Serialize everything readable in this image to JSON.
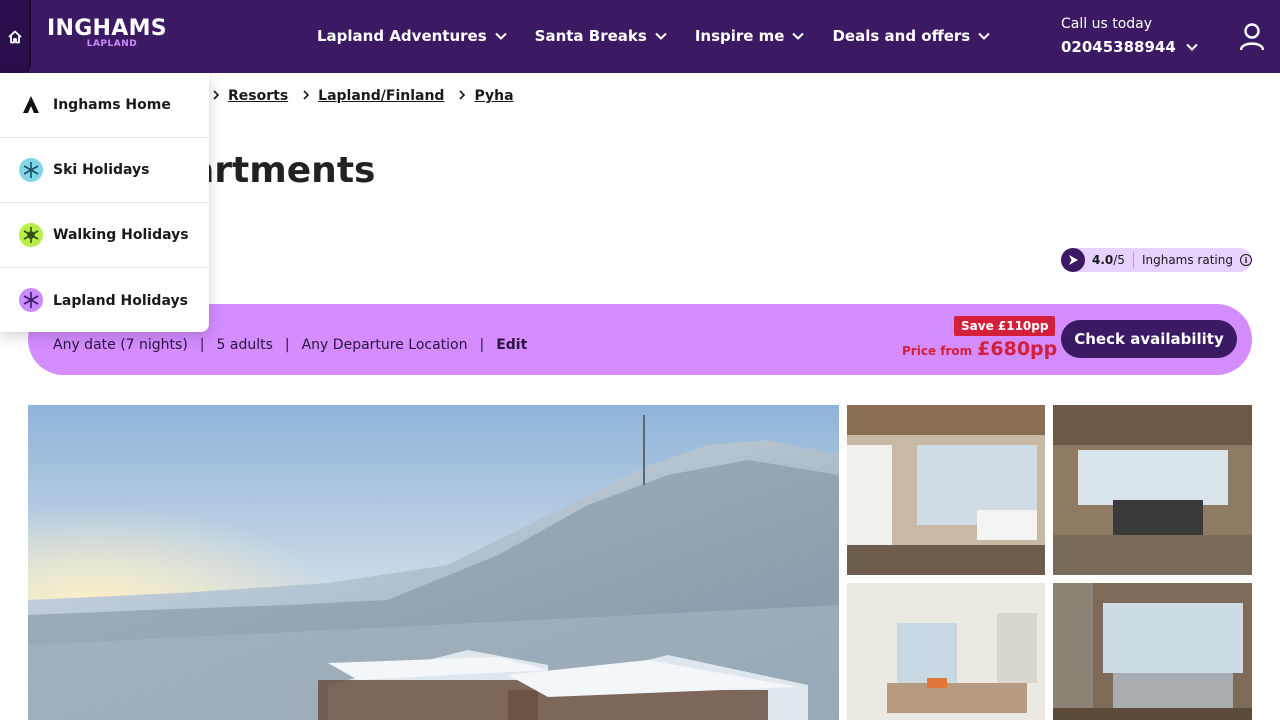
{
  "header": {
    "brand": "INGHAMS",
    "brand_sub": "LAPLAND",
    "nav": [
      {
        "label": "Lapland Adventures"
      },
      {
        "label": "Santa Breaks"
      },
      {
        "label": "Inspire me"
      },
      {
        "label": "Deals and offers"
      }
    ],
    "call_label": "Call us today",
    "call_number": "02045388944"
  },
  "breadcrumb": [
    "Resorts",
    "Lapland/Finland",
    "Pyha"
  ],
  "page_title": "artments",
  "rating": {
    "score": "4.0",
    "out_of": "/5",
    "label": "Inghams rating"
  },
  "search": {
    "dates": "Any date (7 nights)",
    "guests": "5 adults",
    "departure": "Any Departure Location",
    "edit": "Edit",
    "save": "Save £110pp",
    "price_label": "Price from",
    "price_value": "£680pp",
    "cta": "Check availability"
  },
  "dropdown": {
    "items": [
      {
        "label": "Inghams Home",
        "icon": "inghams-logo-icon"
      },
      {
        "label": "Ski Holidays",
        "icon": "snowflake-icon"
      },
      {
        "label": "Walking Holidays",
        "icon": "walking-icon"
      },
      {
        "label": "Lapland Holidays",
        "icon": "lapland-icon"
      }
    ]
  },
  "colors": {
    "header_bg": "#3b1a63",
    "search_bg": "#d48cff",
    "price_red": "#d41f3a",
    "accent_lilac": "#c98bff"
  }
}
